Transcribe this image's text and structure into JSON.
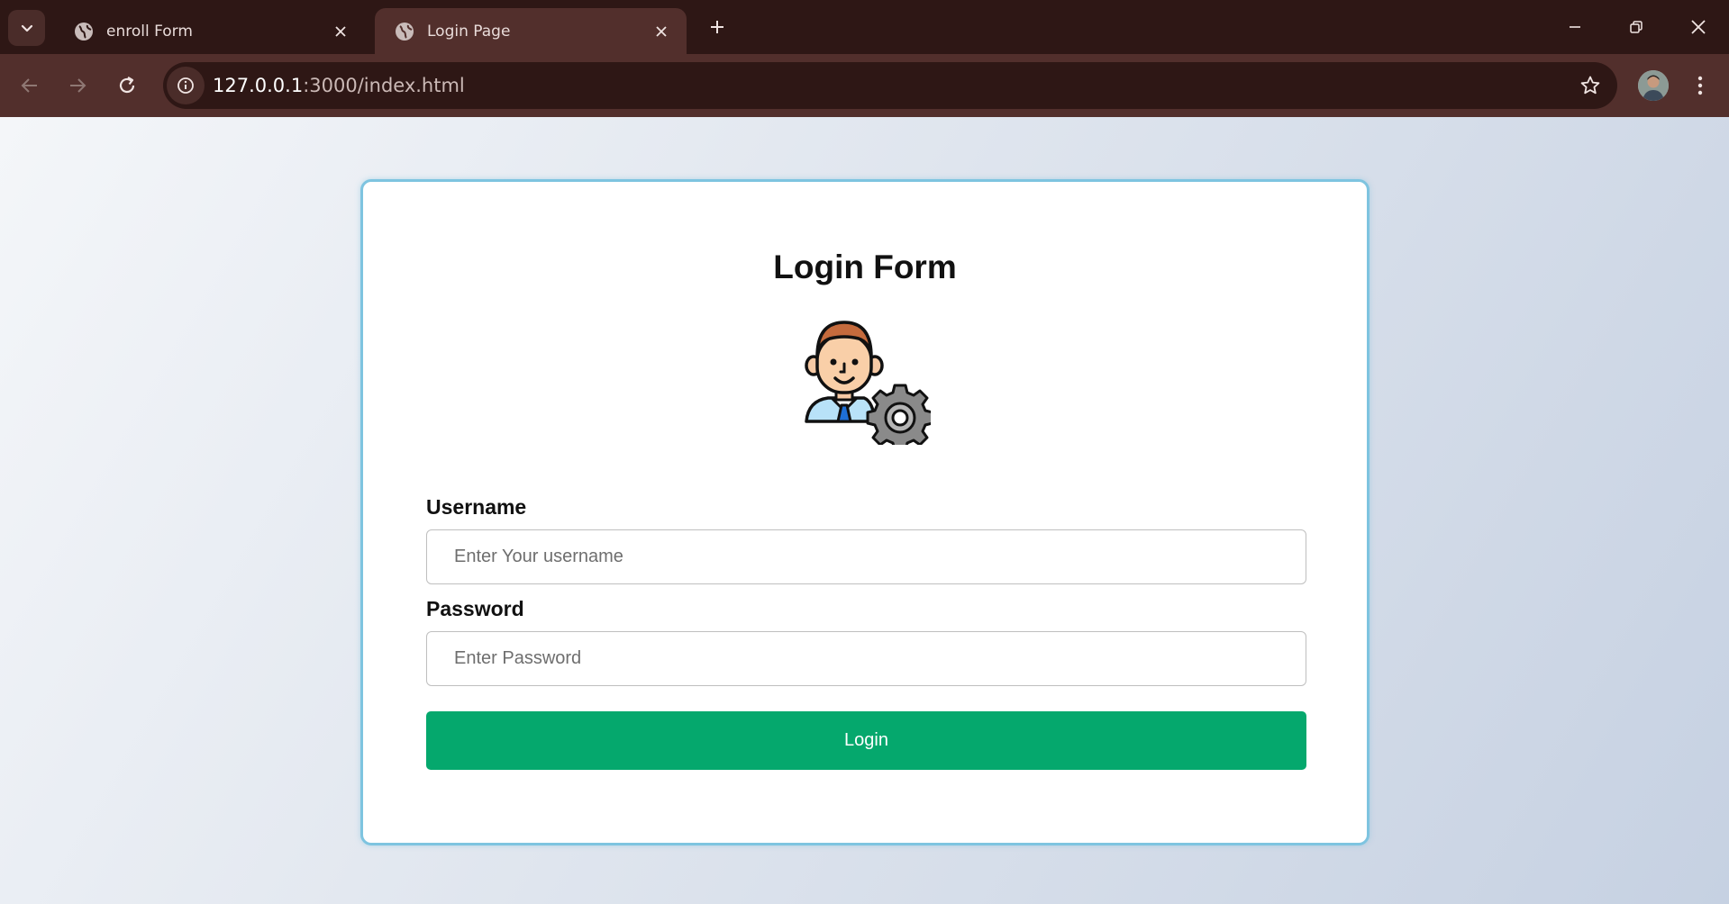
{
  "browser": {
    "tabs": [
      {
        "title": "enroll Form",
        "active": false
      },
      {
        "title": "Login Page",
        "active": true
      }
    ],
    "url_host": "127.0.0.1",
    "url_path": ":3000/index.html"
  },
  "icons": {
    "tab_search": "chevron-down-icon",
    "favicon": "globe-icon",
    "tab_close": "close-icon",
    "new_tab": "plus-icon",
    "minimize": "minimize-icon",
    "restore": "restore-icon",
    "window_close": "close-icon",
    "back": "arrow-left-icon",
    "forward": "arrow-right-icon",
    "reload": "reload-icon",
    "site_info": "info-icon",
    "bookmark": "star-icon",
    "profile": "avatar",
    "menu": "kebab-menu-icon",
    "form_logo": "user-gear-icon"
  },
  "form": {
    "title": "Login Form",
    "username_label": "Username",
    "username_placeholder": "Enter Your username",
    "password_label": "Password",
    "password_placeholder": "Enter Password",
    "submit_label": "Login"
  },
  "colors": {
    "tabstrip": "#2e1715",
    "toolbar": "#522f2c",
    "card_border": "#7ec4e0",
    "login_button": "#05a86d"
  }
}
